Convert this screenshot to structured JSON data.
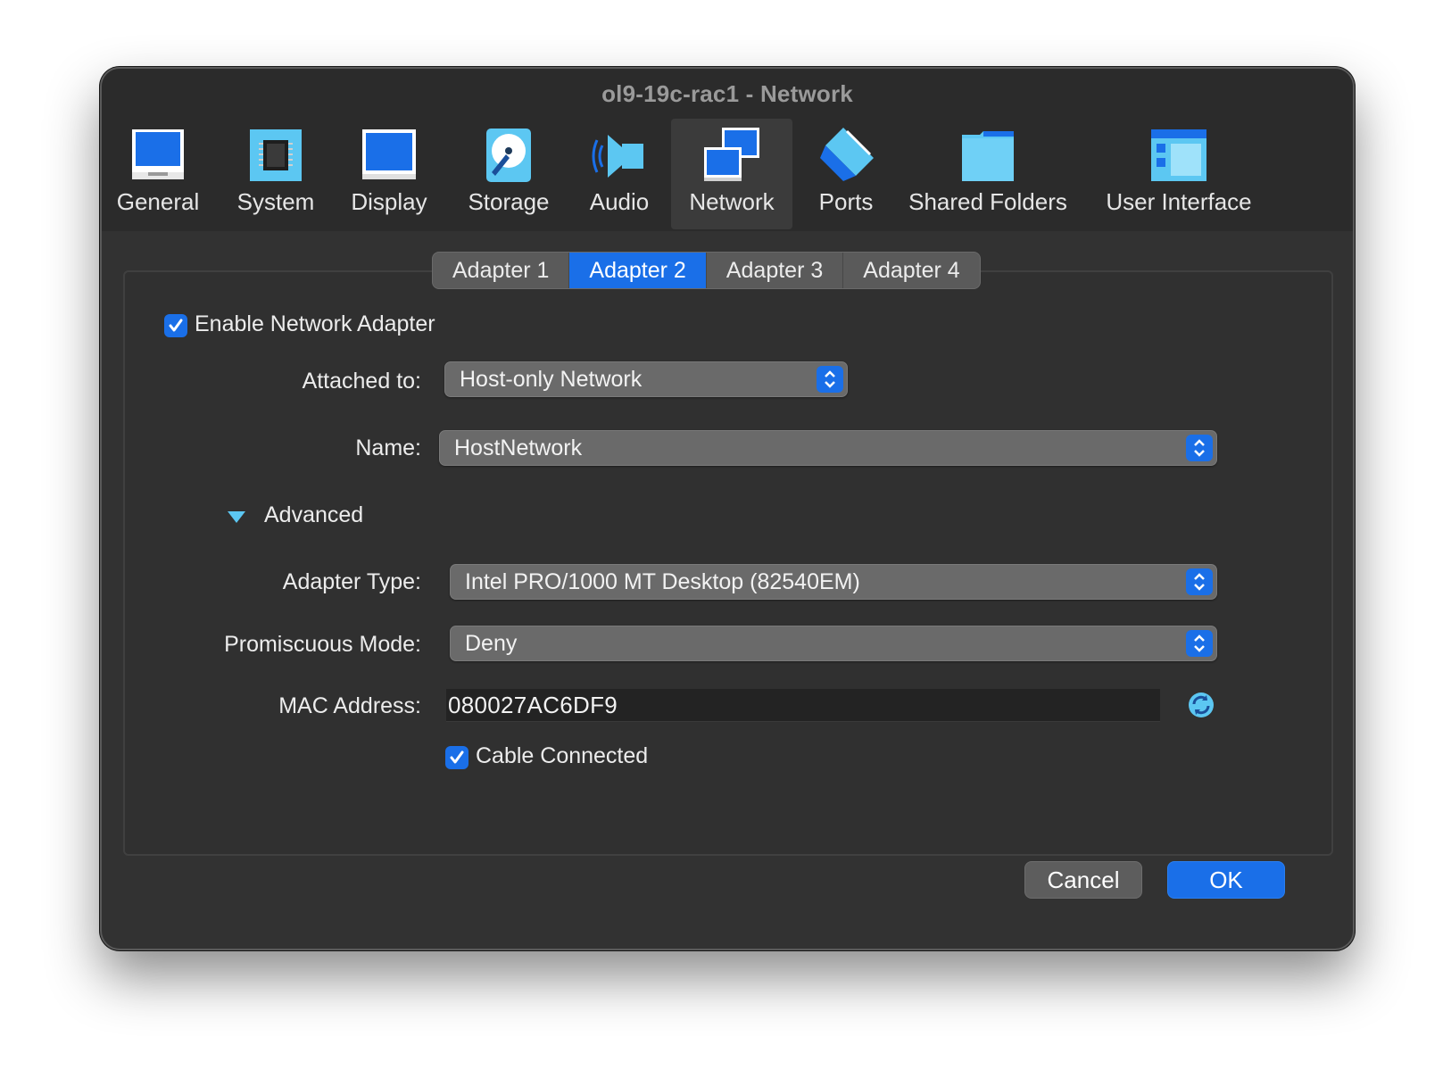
{
  "window": {
    "title": "ol9-19c-rac1 - Network"
  },
  "toolbar": {
    "items": [
      {
        "label": "General",
        "icon": "general-icon"
      },
      {
        "label": "System",
        "icon": "system-icon"
      },
      {
        "label": "Display",
        "icon": "display-icon"
      },
      {
        "label": "Storage",
        "icon": "storage-icon"
      },
      {
        "label": "Audio",
        "icon": "audio-icon"
      },
      {
        "label": "Network",
        "icon": "network-icon",
        "active": true
      },
      {
        "label": "Ports",
        "icon": "ports-icon"
      },
      {
        "label": "Shared Folders",
        "icon": "shared-folders-icon"
      },
      {
        "label": "User Interface",
        "icon": "user-interface-icon"
      }
    ]
  },
  "tabs": {
    "items": [
      "Adapter 1",
      "Adapter 2",
      "Adapter 3",
      "Adapter 4"
    ],
    "selected": "Adapter 2"
  },
  "form": {
    "enable_adapter": {
      "label": "Enable Network Adapter",
      "checked": true
    },
    "attached_to": {
      "label": "Attached to:",
      "value": "Host-only Network"
    },
    "name": {
      "label": "Name:",
      "value": "HostNetwork"
    },
    "advanced": {
      "label": "Advanced",
      "expanded": true
    },
    "adapter_type": {
      "label": "Adapter Type:",
      "value": "Intel PRO/1000 MT Desktop (82540EM)"
    },
    "promiscuous_mode": {
      "label": "Promiscuous Mode:",
      "value": "Deny"
    },
    "mac_address": {
      "label": "MAC Address:",
      "value": "080027AC6DF9"
    },
    "cable_connected": {
      "label": "Cable Connected",
      "checked": true
    }
  },
  "buttons": {
    "cancel": "Cancel",
    "ok": "OK"
  },
  "colors": {
    "accent": "#1a6fe8",
    "window_bg": "#323232",
    "toolbar_bg": "#2b2b2b",
    "text": "#ececec"
  }
}
